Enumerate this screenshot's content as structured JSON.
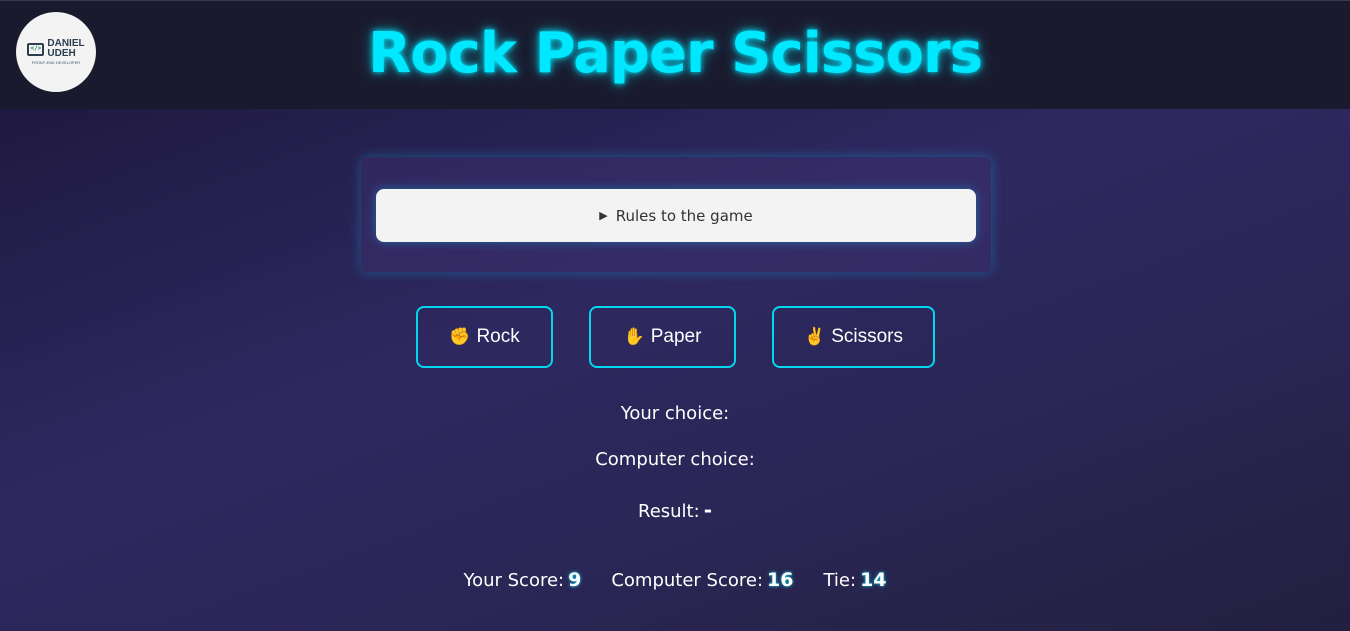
{
  "header": {
    "title": "Rock Paper Scissors",
    "logo": {
      "line1": "DANIEL",
      "line2": "UDEH",
      "subtitle": "FRONT-END DEVELOPER",
      "icon": "monitor-code-icon"
    }
  },
  "rules": {
    "label": "Rules to the game",
    "icon": "disclosure-triangle-icon"
  },
  "choices": [
    {
      "emoji": "✊",
      "label": "Rock"
    },
    {
      "emoji": "✋",
      "label": "Paper"
    },
    {
      "emoji": "✌️",
      "label": "Scissors"
    }
  ],
  "status": {
    "your_choice_label": "Your choice:",
    "computer_choice_label": "Computer choice:",
    "result_label": "Result:",
    "result_value": "-"
  },
  "scores": {
    "your_label": "Your Score:",
    "your_value": "9",
    "computer_label": "Computer Score:",
    "computer_value": "16",
    "tie_label": "Tie:",
    "tie_value": "14"
  },
  "colors": {
    "accent": "#00e8ff",
    "header_bg": "#1a1a2e",
    "background": "#2e2860"
  }
}
